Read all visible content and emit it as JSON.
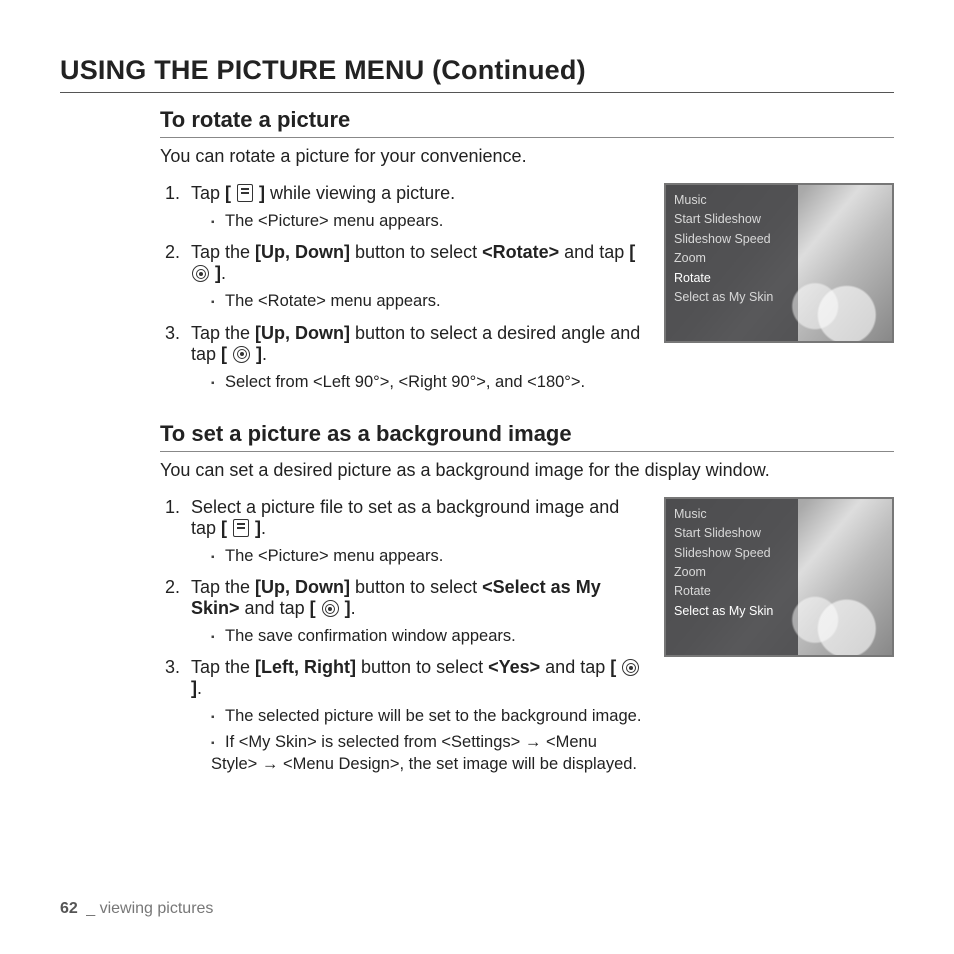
{
  "title": "USING THE PICTURE MENU (Continued)",
  "section1": {
    "heading": "To rotate a picture",
    "intro": "You can rotate a picture for your convenience.",
    "steps": [
      {
        "pre": "Tap ",
        "bold": "[ ",
        "icon": "menu",
        "bold2": " ]",
        "post": " while viewing a picture.",
        "notes": [
          "The <Picture> menu appears."
        ]
      },
      {
        "pre": "Tap the ",
        "bold": "[Up, Down]",
        "post": " button to select ",
        "bold3": "<Rotate>",
        "post2": " and tap ",
        "bold4": "[ ",
        "icon2": "ring",
        "bold5": " ]",
        "post3": ".",
        "notes": [
          "The <Rotate> menu appears."
        ]
      },
      {
        "pre": "Tap the ",
        "bold": "[Up, Down]",
        "post": " button to select a desired angle and tap ",
        "bold4": "[ ",
        "icon2": "ring",
        "bold5": " ]",
        "post3": ".",
        "notes": [
          "Select from <Left 90°>, <Right 90°>, and <180°>."
        ]
      }
    ],
    "menu": [
      "Music",
      "Start Slideshow",
      "Slideshow Speed",
      "Zoom",
      "Rotate",
      "Select as My Skin"
    ],
    "selectedIndex": 4
  },
  "section2": {
    "heading": "To set a picture as a background image",
    "intro": "You can set a desired picture as a background image for the display window.",
    "steps": [
      {
        "pre": "Select a picture file to set as a background image and tap ",
        "bold": "[ ",
        "icon": "menu",
        "bold2": " ]",
        "post": ".",
        "notes": [
          "The <Picture> menu appears."
        ]
      },
      {
        "pre": "Tap the ",
        "bold": "[Up, Down]",
        "post": " button to select ",
        "bold3": "<Select as My Skin>",
        "post2": " and tap ",
        "bold4": "[ ",
        "icon2": "ring",
        "bold5": " ]",
        "post3": ".",
        "notes": [
          "The save confirmation window appears."
        ]
      },
      {
        "pre": "Tap the ",
        "bold": "[Left, Right]",
        "post": " button to select ",
        "bold3": "<Yes>",
        "post2": " and tap ",
        "bold4": "[ ",
        "icon2": "ring",
        "bold5": " ]",
        "post3": ".",
        "notes": [
          "The selected picture will be set to the background image.",
          "If <My Skin> is selected from <Settings> → <Menu Style> → <Menu Design>, the set image will be displayed."
        ]
      }
    ],
    "menu": [
      "Music",
      "Start Slideshow",
      "Slideshow Speed",
      "Zoom",
      "Rotate",
      "Select as My Skin"
    ],
    "selectedIndex": 5
  },
  "footer": {
    "page": "62",
    "sep": " _ ",
    "chapter": "viewing pictures"
  }
}
